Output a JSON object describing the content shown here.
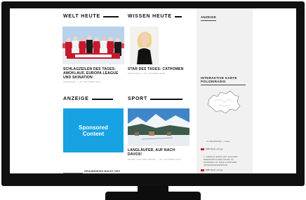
{
  "sections": {
    "welt_heute": "WELT HEUTE",
    "wissen_heute": "WISSEN HEUTE",
    "anzeige_main": "ANZEIGE",
    "sport": "SPORT"
  },
  "stories": {
    "welt": {
      "title_lines": [
        "SCHLAGZEILEN DES TAGES:",
        "AMOKLAUF, EUROPA LEAGUE",
        "UND SKINATION"
      ],
      "meta": "GEPOSTET — 25. OKTOBER 2016"
    },
    "wissen": {
      "title_lines": [
        "STAR DES TAGES: CATHOMEN"
      ],
      "meta": "GEPOSTET — 25. OKTOBER 2016"
    },
    "sport": {
      "title_lines": [
        "LANGLÄUFER, AUF NACH",
        "DAVOS!"
      ],
      "meta": "NEUES VOM DER SPORT — 25. OKTOBER 2016"
    },
    "bottom": {
      "title": "GRAUBÜNDEN MACHT DES"
    }
  },
  "sponsored": {
    "line1": "Sponsored",
    "line2": "Content"
  },
  "sidebar": {
    "anzeige": "ANZEIGE",
    "karte_title_lines": [
      "INTERAKTIVE KARTE",
      "POLIZEIRADIO"
    ],
    "karte_caption": "rtr.ch/polizeifunk — Karte",
    "orf1": "ORF Sport +Im.gp",
    "news_lines": [
      "1. Volksbug: Stoiber-Hirn; Feuerwehr",
      "Staatsbahnhof Maier Kreativ mit",
      "Grauhaiden. Dr. Ende/ 3 KMT/1010",
      "ANTRAGSWORKSTAND..."
    ],
    "orf2": "ORF Sport +Im.gp"
  },
  "colors": {
    "sponsored_bg": "#17a3e3",
    "sidebar_bg": "#f1f1f1",
    "orf_flag": "#d21d1d",
    "bezel": "#101010"
  }
}
